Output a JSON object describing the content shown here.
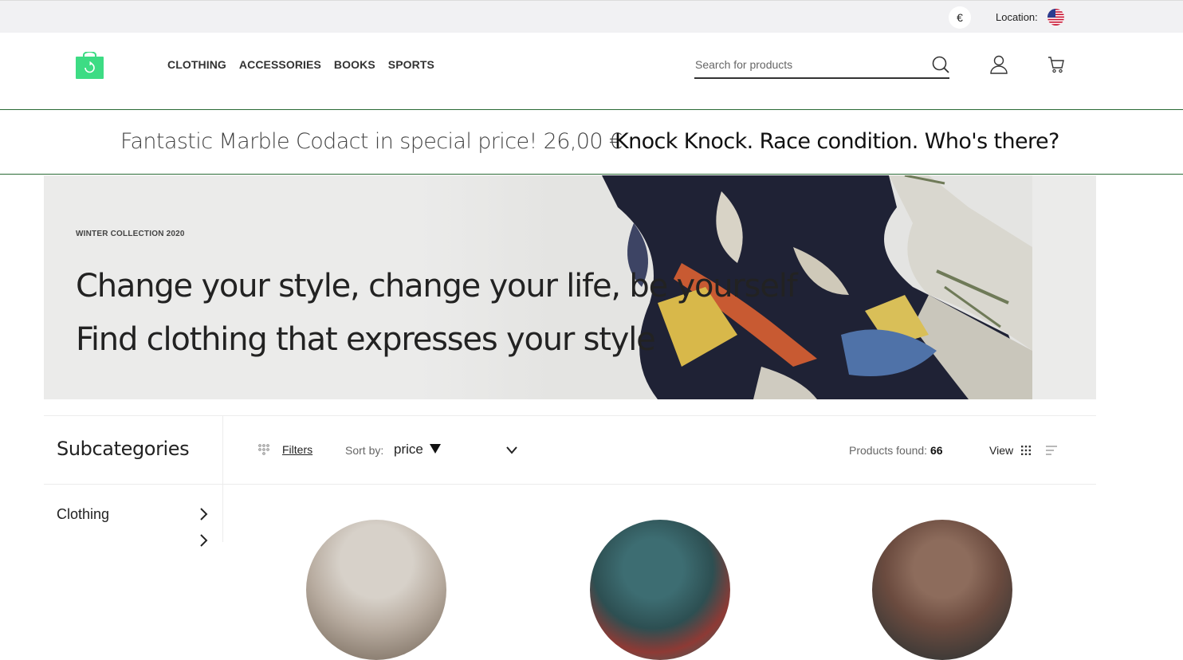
{
  "topbar": {
    "currency_symbol": "€",
    "location_label": "Location:",
    "flag_icon": "us-flag-icon"
  },
  "header": {
    "logo_icon": "shopping-bag-logo-icon",
    "nav": [
      "CLOTHING",
      "ACCESSORIES",
      "BOOKS",
      "SPORTS"
    ],
    "search_placeholder": "Search for products",
    "icons": [
      "search-icon",
      "user-icon",
      "cart-icon"
    ],
    "accent_color": "#3ddc84"
  },
  "promo": {
    "offer_text": "Fantastic Marble Codact in special price! 26,00 €",
    "joke_text": "Knock Knock. Race condition. Who's there?"
  },
  "hero": {
    "tag": "WINTER COLLECTION 2020",
    "line1": "Change your style, change your life, be yourself",
    "line2": "Find clothing that expresses your style"
  },
  "listing": {
    "subcategories_title": "Subcategories",
    "subcategories": [
      "Clothing"
    ],
    "filters_label": "Filters",
    "sortby_label": "Sort by:",
    "sort_value": "price",
    "products_found_label": "Products found:",
    "products_found_count": "66",
    "view_label": "View"
  }
}
